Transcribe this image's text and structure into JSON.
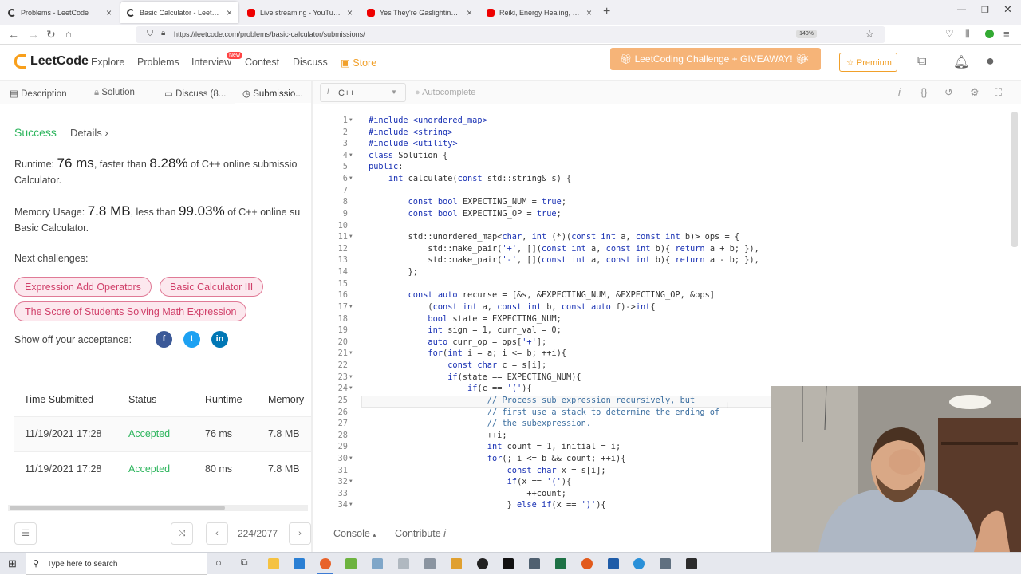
{
  "browser": {
    "tabs": [
      {
        "title": "Problems - LeetCode",
        "icon": "leetcode-favicon",
        "active": false
      },
      {
        "title": "Basic Calculator - LeetCode",
        "icon": "leetcode-favicon",
        "active": true
      },
      {
        "title": "Live streaming - YouTube Studio",
        "icon": "youtube-favicon",
        "active": false
      },
      {
        "title": "Yes They're Gaslighting You, an...",
        "icon": "youtube-favicon",
        "active": false
      },
      {
        "title": "Reiki, Energy Healing, & \"Laying...",
        "icon": "youtube-favicon",
        "active": false
      }
    ],
    "url": "https://leetcode.com/problems/basic-calculator/submissions/",
    "zoom": "140%"
  },
  "header": {
    "logo": "LeetCode",
    "nav": [
      "Explore",
      "Problems",
      "Interview",
      "Contest",
      "Discuss",
      "Store"
    ],
    "new_badge": "New",
    "giveaway": "LeetCoding Challenge + GIVEAWAY!",
    "premium": "Premium"
  },
  "left_tabs": [
    "Description",
    "Solution",
    "Discuss (8...",
    "Submissio..."
  ],
  "result": {
    "status": "Success",
    "details": "Details",
    "runtime_label": "Runtime:",
    "runtime_value": "76 ms",
    "runtime_mid": ", faster than",
    "runtime_pct": "8.28%",
    "runtime_tail": "of C++ online submissio",
    "runtime_line2": "Calculator.",
    "memory_label": "Memory Usage:",
    "memory_value": "7.8 MB",
    "memory_mid": ", less than",
    "memory_pct": "99.03%",
    "memory_tail": "of C++ online su",
    "memory_line2": "Basic Calculator.",
    "next_label": "Next challenges:",
    "challenges": [
      "Expression Add Operators",
      "Basic Calculator III",
      "The Score of Students Solving Math Expression"
    ],
    "share_label": "Show off your acceptance:"
  },
  "submissions": {
    "headers": [
      "Time Submitted",
      "Status",
      "Runtime",
      "Memory"
    ],
    "rows": [
      {
        "time": "11/19/2021 17:28",
        "status": "Accepted",
        "runtime": "76 ms",
        "memory": "7.8 MB"
      },
      {
        "time": "11/19/2021 17:28",
        "status": "Accepted",
        "runtime": "80 ms",
        "memory": "7.8 MB"
      }
    ]
  },
  "pager": {
    "text": "224/2077"
  },
  "editor": {
    "language": "C++",
    "autocomplete": "Autocomplete",
    "lines": [
      "#include <unordered_map>",
      "#include <string>",
      "#include <utility>",
      "class Solution {",
      "public:",
      "    int calculate(const std::string& s) {",
      "",
      "        const bool EXPECTING_NUM = true;",
      "        const bool EXPECTING_OP = true;",
      "",
      "        std::unordered_map<char, int (*)(const int a, const int b)> ops = {",
      "            std::make_pair('+', [](const int a, const int b){ return a + b; }),",
      "            std::make_pair('-', [](const int a, const int b){ return a - b; }),",
      "        };",
      "",
      "        const auto recurse = [&s, &EXPECTING_NUM, &EXPECTING_OP, &ops]",
      "            (const int a, const int b, const auto f)->int{",
      "            bool state = EXPECTING_NUM;",
      "            int sign = 1, curr_val = 0;",
      "            auto curr_op = ops['+'];",
      "            for(int i = a; i <= b; ++i){",
      "                const char c = s[i];",
      "                if(state == EXPECTING_NUM){",
      "                    if(c == '('){",
      "                        // Process sub expression recursively, but",
      "                        // first use a stack to determine the ending of",
      "                        // the subexpression.",
      "                        ++i;",
      "                        int count = 1, initial = i;",
      "                        for(; i <= b && count; ++i){",
      "                            const char x = s[i];",
      "                            if(x == '('){",
      "                                ++count;",
      "                            } else if(x == ')'){"
    ],
    "fold_lines": [
      1,
      4,
      6,
      11,
      17,
      21,
      23,
      24,
      30,
      32,
      34
    ]
  },
  "console": {
    "console": "Console",
    "contribute": "Contribute"
  },
  "taskbar": {
    "search_placeholder": "Type here to search"
  }
}
